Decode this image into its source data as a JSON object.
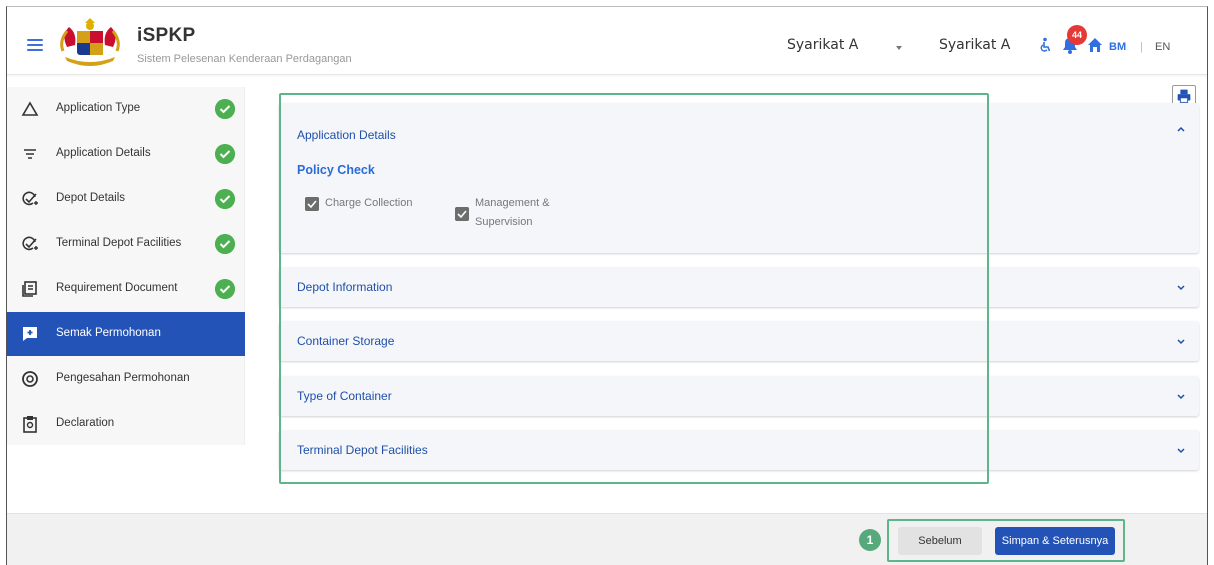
{
  "header": {
    "app_name": "iSPKP",
    "app_subtitle": "Sistem Pelesenan Kenderaan Perdagangan",
    "company_selector": "Syarikat A",
    "company_name": "Syarikat A",
    "notification_count": "44",
    "lang_bm": "BM",
    "lang_separator": "|",
    "lang_en": "EN"
  },
  "sidebar": {
    "items": [
      {
        "label": "Application Type",
        "icon": "triangle-icon",
        "completed": true
      },
      {
        "label": "Application Details",
        "icon": "filter-icon",
        "completed": true
      },
      {
        "label": "Depot Details",
        "icon": "check-add-icon",
        "completed": true
      },
      {
        "label": "Terminal Depot Facilities",
        "icon": "check-add-icon",
        "completed": true
      },
      {
        "label": "Requirement Document",
        "icon": "document-icon",
        "completed": true
      },
      {
        "label": "Semak Permohonan",
        "icon": "review-icon",
        "completed": false,
        "active": true
      },
      {
        "label": "Pengesahan Permohonan",
        "icon": "verify-icon",
        "completed": false
      },
      {
        "label": "Declaration",
        "icon": "clipboard-icon",
        "completed": false
      }
    ]
  },
  "main": {
    "sections": [
      {
        "title": "Application Details",
        "expanded": true
      },
      {
        "title": "Depot Information",
        "expanded": false
      },
      {
        "title": "Container Storage",
        "expanded": false
      },
      {
        "title": "Type of Container",
        "expanded": false
      },
      {
        "title": "Terminal Depot Facilities",
        "expanded": false
      }
    ],
    "policy_check": {
      "heading": "Policy Check",
      "options": [
        {
          "label": "Charge Collection",
          "checked": true
        },
        {
          "label_line1": "Management &",
          "label_line2": "Supervision",
          "checked": true
        }
      ]
    }
  },
  "footer": {
    "step_marker": "1",
    "prev_label": "Sebelum",
    "next_label": "Simpan & Seterusnya"
  },
  "colors": {
    "primary": "#2453b8",
    "success": "#4caf50",
    "highlight": "#5fb48a",
    "badge": "#e53935"
  }
}
